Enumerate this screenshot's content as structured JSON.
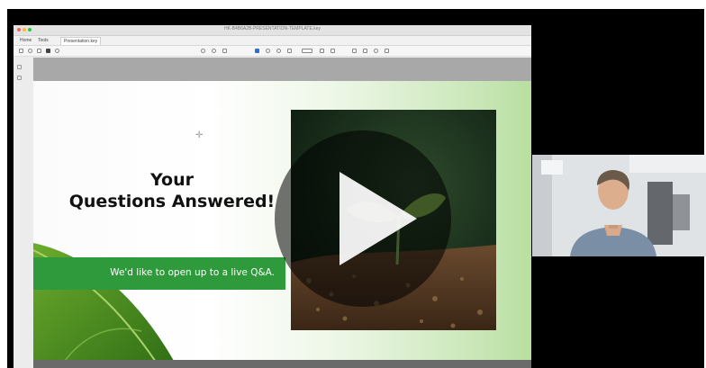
{
  "window": {
    "title": "HK-B4B6A2B-PRESENTATION-TEMPLATE.key",
    "tabs": [
      {
        "label": "Home"
      },
      {
        "label": "Tools"
      },
      {
        "label": "Presentation.key"
      }
    ],
    "traffic_colors": [
      "#ff5f57",
      "#febc2e",
      "#28c840"
    ]
  },
  "slide": {
    "title_line1": "Your",
    "title_line2": "Questions Answered!",
    "banner_text": "We'd like to open up to a live Q&A.",
    "accent_color": "#2f9a3c"
  },
  "video": {
    "play_icon": "play-icon"
  },
  "webcam": {
    "participant_icon": "presenter-video"
  }
}
